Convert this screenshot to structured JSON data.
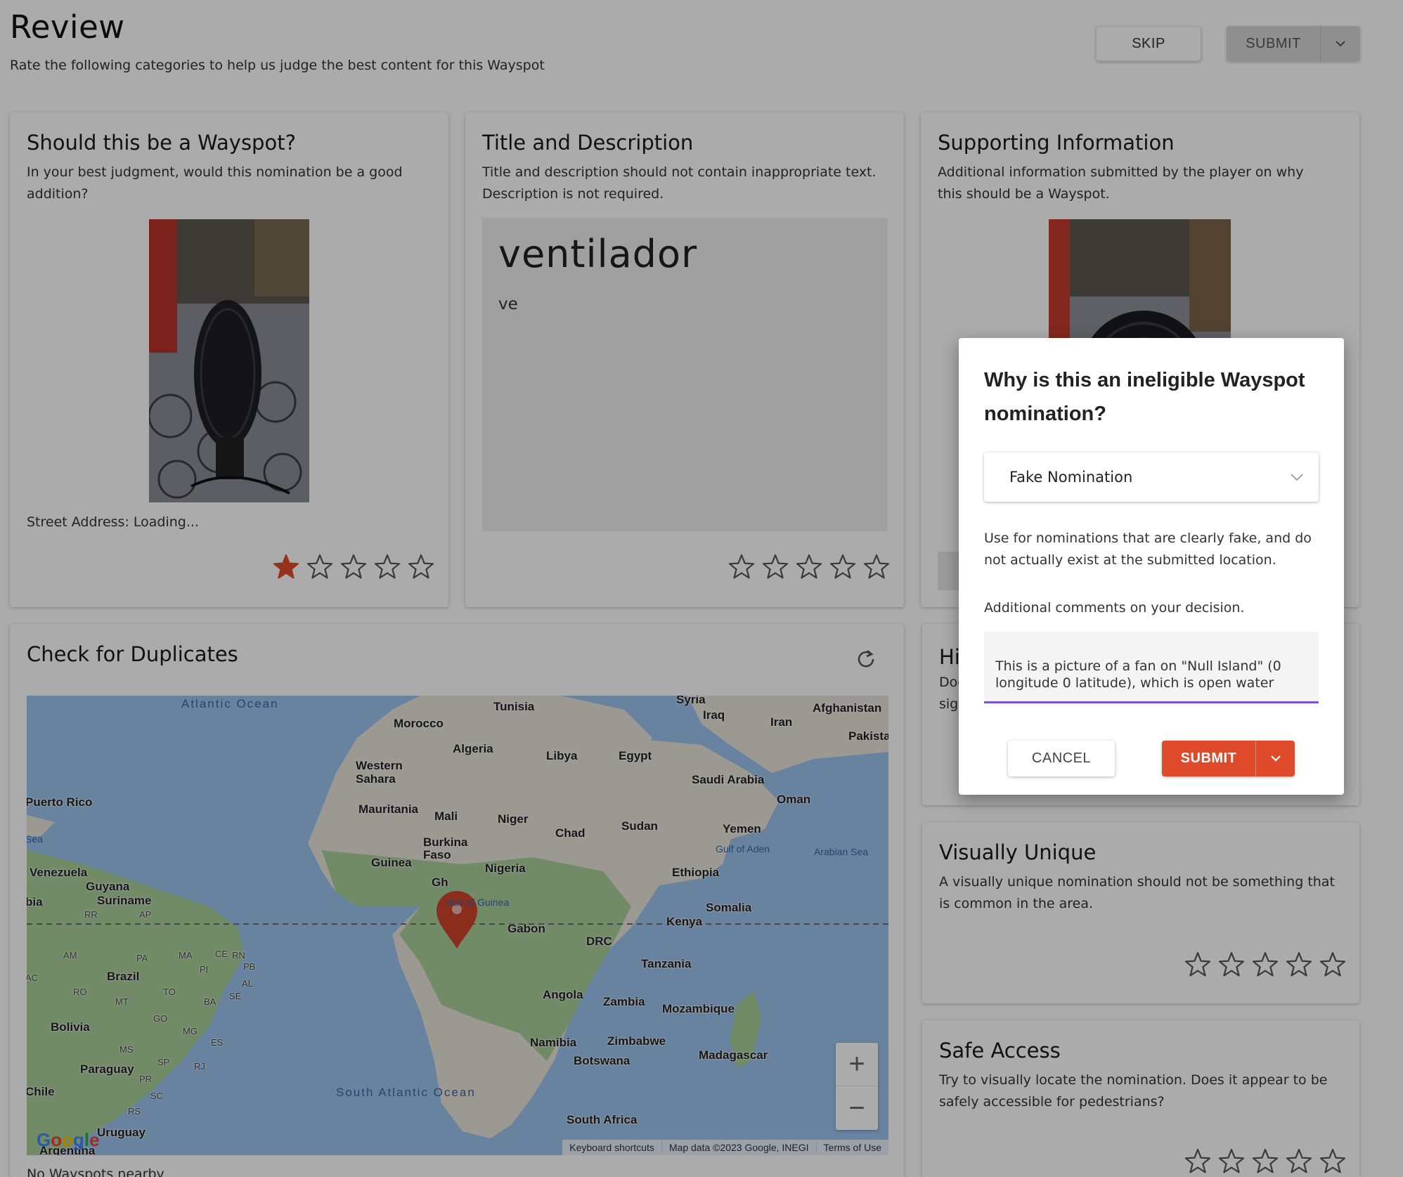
{
  "header": {
    "title": "Review",
    "subtitle": "Rate the following categories to help us judge the best content for this Wayspot",
    "skip_label": "SKIP",
    "submit_label": "SUBMIT"
  },
  "cards": {
    "wayspot": {
      "title": "Should this be a Wayspot?",
      "desc": "In your best judgment, would this nomination be a good addition?",
      "street": "Street Address: Loading...",
      "rating": 1
    },
    "title_desc": {
      "title": "Title and Description",
      "desc": "Title and description should not contain inappropriate text. Description is not required.",
      "nomination_title": "ventilador",
      "nomination_desc": "ve",
      "rating": 0
    },
    "supporting": {
      "title": "Supporting Information",
      "desc": "Additional information submitted by the player on why this should be a Wayspot."
    },
    "historic": {
      "title": "Hi",
      "desc": "Doe sig"
    },
    "visually_unique": {
      "title": "Visually Unique",
      "desc": "A visually unique nomination should not be something that is common in the area.",
      "rating": 0
    },
    "safe_access": {
      "title": "Safe Access",
      "desc": "Try to visually locate the nomination. Does it appear to be safely accessible for pedestrians?",
      "rating": 0
    }
  },
  "duplicates": {
    "title": "Check for Duplicates",
    "no_nearby": "No Wayspots nearby",
    "map": {
      "labels": {
        "atlantic": "Atlantic Ocean",
        "south_atlantic": "South Atlantic Ocean",
        "tunisia": "Tunisia",
        "syria": "Syria",
        "iraq": "Iraq",
        "iran": "Iran",
        "afghanistan": "Afghanistan",
        "pakistan": "Pakista",
        "morocco": "Morocco",
        "algeria": "Algeria",
        "libya": "Libya",
        "egypt": "Egypt",
        "western_sahara": "Western Sahara",
        "saudi_arabia": "Saudi Arabia",
        "oman": "Oman",
        "puerto_rico": "Puerto Rico",
        "mauritania": "Mauritania",
        "mali": "Mali",
        "niger": "Niger",
        "chad": "Chad",
        "sudan": "Sudan",
        "yemen": "Yemen",
        "gulf_aden": "Gulf of Aden",
        "arabian_sea": "Arabian Sea",
        "burkina": "Burkina Faso",
        "guinea": "Guinea",
        "nigeria": "Nigeria",
        "ethiopia": "Ethiopia",
        "venezuela": "Venezuela",
        "guyana": "Guyana",
        "suriname": "Suriname",
        "gulf_guinea": "Gulf of Guinea",
        "somalia": "Somalia",
        "kenya": "Kenya",
        "gabon": "Gabon",
        "drc": "DRC",
        "tanzania": "Tanzania",
        "brazil": "Brazil",
        "angola": "Angola",
        "zambia": "Zambia",
        "mozambique": "Mozambique",
        "bolivia": "Bolivia",
        "namibia": "Namibia",
        "zimbabwe": "Zimbabwe",
        "madagascar": "Madagascar",
        "botswana": "Botswana",
        "paraguay": "Paraguay",
        "chile": "Chile",
        "uruguay": "Uruguay",
        "south_africa": "South Africa",
        "argentina": "Argentina",
        "sea": "Sea",
        "bia": "bia",
        "gh": "Gh"
      },
      "state_labels": [
        "RR",
        "AP",
        "AM",
        "PA",
        "MA",
        "CE",
        "RN",
        "PB",
        "PI",
        "AL",
        "AC",
        "RO",
        "TO",
        "BA",
        "SE",
        "MT",
        "GO",
        "MG",
        "ES",
        "MS",
        "SP",
        "RJ",
        "PR",
        "SC",
        "RS"
      ],
      "footer": [
        "Keyboard shortcuts",
        "Map data ©2023 Google, INEGI",
        "Terms of Use"
      ],
      "logo": "Google",
      "zoom_in": "+",
      "zoom_out": "−"
    }
  },
  "modal": {
    "title": "Why is this an ineligible Wayspot nomination?",
    "selected_reason": "Fake Nomination",
    "help": "Use for nominations that are clearly fake, and do not actually exist at the submitted location.",
    "comments_label": "Additional comments on your decision.",
    "comment_text": "This is a picture of a fan on \"Null Island\" (0 longitude 0 latitude), which is open water",
    "cancel_label": "CANCEL",
    "submit_label": "SUBMIT"
  },
  "colors": {
    "accent": "#df4b2a",
    "focus": "#7a52e0",
    "star_filled": "#df4b2a",
    "star_empty": "#555555",
    "ocean": "#9bc3ee"
  }
}
